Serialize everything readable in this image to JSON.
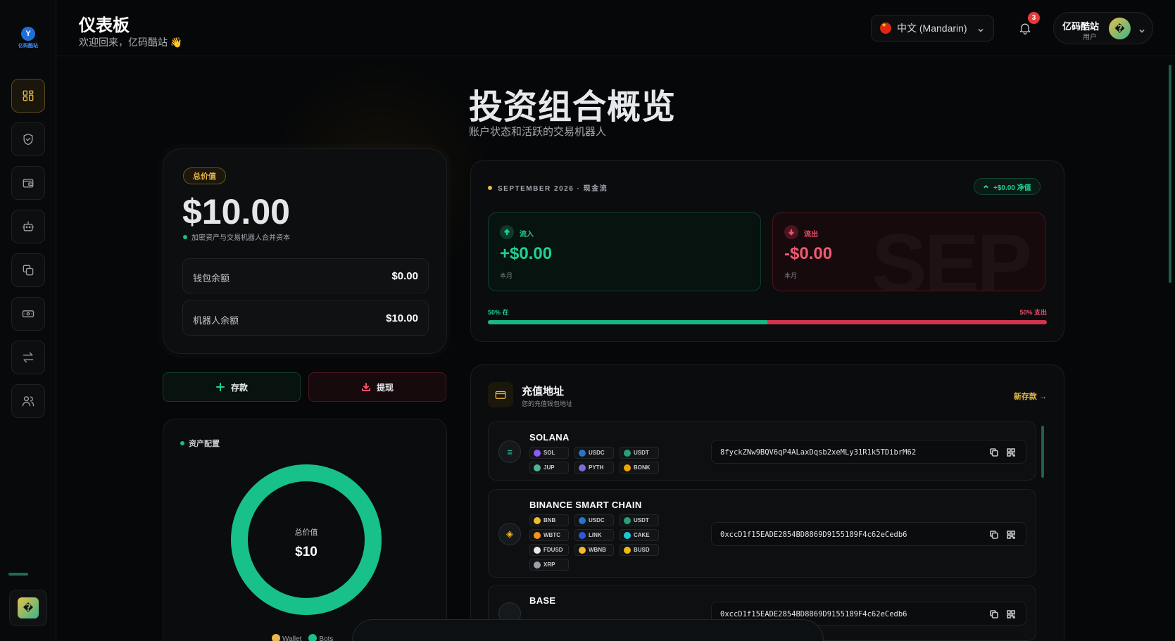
{
  "brand": {
    "logo_mark": "Y",
    "logo_text": "亿码酷站"
  },
  "sidebar": {
    "items": [
      {
        "name": "dashboard",
        "icon": "grid-icon",
        "active": true
      },
      {
        "name": "security",
        "icon": "shield-icon",
        "active": false
      },
      {
        "name": "wallet",
        "icon": "wallet-icon",
        "active": false
      },
      {
        "name": "bots",
        "icon": "bot-icon",
        "active": false
      },
      {
        "name": "copy",
        "icon": "copy-icon",
        "active": false
      },
      {
        "name": "cash",
        "icon": "cash-icon",
        "active": false
      },
      {
        "name": "transfer",
        "icon": "transfer-icon",
        "active": false
      },
      {
        "name": "users",
        "icon": "users-icon",
        "active": false
      }
    ],
    "avatar_glyph": "�"
  },
  "header": {
    "title": "仪表板",
    "subtitle": "欢迎回来，亿码酷站 👋",
    "language": "中文 (Mandarin)",
    "notifications": "3",
    "user_name": "亿码酷站",
    "user_role": "用户",
    "avatar_glyph": "�"
  },
  "overview": {
    "title": "投资组合概览",
    "subtitle": "账户状态和活跃的交易机器人"
  },
  "total": {
    "label": "总价值",
    "value": "$10.00",
    "note": "加密资产与交易机器人合并资本",
    "wallet_label": "钱包余额",
    "wallet_value": "$0.00",
    "bot_label": "机器人余额",
    "bot_value": "$10.00"
  },
  "actions": {
    "deposit": "存款",
    "withdraw": "提现"
  },
  "allocation": {
    "label": "资产配置",
    "center_label": "总价值",
    "center_value": "$10",
    "legend": [
      {
        "name": "Wallet",
        "color": "#e9b949"
      },
      {
        "name": "Bots",
        "color": "#18c08a"
      }
    ],
    "wallet_fraction": 0,
    "bots_fraction": 1
  },
  "month": {
    "label": "SEPTEMBER 2026 · 现金流",
    "net": "+$0.00 净值",
    "inflow_label": "流入",
    "inflow_value": "+$0.00",
    "inflow_sub": "本月",
    "outflow_label": "流出",
    "outflow_value": "-$0.00",
    "outflow_sub": "本月",
    "watermark": "SEP",
    "in_pct_label": "50% 在",
    "out_pct_label": "50% 支出",
    "in_fraction": 0.5
  },
  "addresses": {
    "title": "充值地址",
    "subtitle": "您的充值钱包地址",
    "new_link": "新存款 →",
    "chains": [
      {
        "name": "SOLANA",
        "logo": "≡",
        "logo_color": "#29d4b3",
        "address": "8fyckZNw9BQV6qP4ALaxDqsb2xeMLy31R1k5TDibrM62",
        "tokens": [
          {
            "sym": "SOL",
            "color": "#8b5cf6"
          },
          {
            "sym": "USDC",
            "color": "#2775ca"
          },
          {
            "sym": "USDT",
            "color": "#26a17b"
          },
          {
            "sym": "JUP",
            "color": "#4fb39a"
          },
          {
            "sym": "PYTH",
            "color": "#7d6bd6"
          },
          {
            "sym": "BONK",
            "color": "#f0a500"
          }
        ]
      },
      {
        "name": "BINANCE SMART CHAIN",
        "logo": "◈",
        "logo_color": "#f3ba2f",
        "address": "0xccD1f15EADE2854BD8869D9155189F4c62eCedb6",
        "tokens": [
          {
            "sym": "BNB",
            "color": "#f3ba2f"
          },
          {
            "sym": "USDC",
            "color": "#2775ca"
          },
          {
            "sym": "USDT",
            "color": "#26a17b"
          },
          {
            "sym": "WBTC",
            "color": "#f7931a"
          },
          {
            "sym": "LINK",
            "color": "#2a5ada"
          },
          {
            "sym": "CAKE",
            "color": "#1fc7d4"
          },
          {
            "sym": "FDUSD",
            "color": "#e8e8e8"
          },
          {
            "sym": "WBNB",
            "color": "#f3ba2f"
          },
          {
            "sym": "BUSD",
            "color": "#f0b90b"
          },
          {
            "sym": "XRP",
            "color": "#9aa1a8"
          }
        ]
      },
      {
        "name": "BASE",
        "logo": "",
        "logo_color": "#2151f5",
        "address": "0xccD1f15EADE2854BD8869D9155189F4c62eCedb6",
        "tokens": []
      }
    ]
  }
}
